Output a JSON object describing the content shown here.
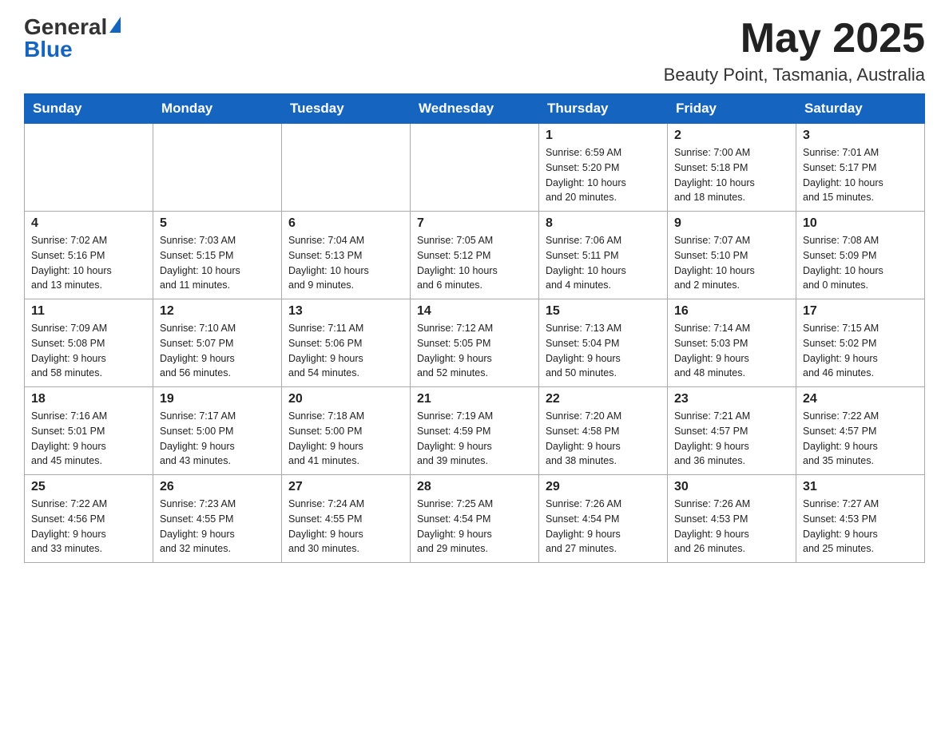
{
  "header": {
    "logo_general": "General",
    "logo_blue": "Blue",
    "month": "May 2025",
    "location": "Beauty Point, Tasmania, Australia"
  },
  "days_of_week": [
    "Sunday",
    "Monday",
    "Tuesday",
    "Wednesday",
    "Thursday",
    "Friday",
    "Saturday"
  ],
  "weeks": [
    [
      {
        "day": "",
        "info": ""
      },
      {
        "day": "",
        "info": ""
      },
      {
        "day": "",
        "info": ""
      },
      {
        "day": "",
        "info": ""
      },
      {
        "day": "1",
        "info": "Sunrise: 6:59 AM\nSunset: 5:20 PM\nDaylight: 10 hours\nand 20 minutes."
      },
      {
        "day": "2",
        "info": "Sunrise: 7:00 AM\nSunset: 5:18 PM\nDaylight: 10 hours\nand 18 minutes."
      },
      {
        "day": "3",
        "info": "Sunrise: 7:01 AM\nSunset: 5:17 PM\nDaylight: 10 hours\nand 15 minutes."
      }
    ],
    [
      {
        "day": "4",
        "info": "Sunrise: 7:02 AM\nSunset: 5:16 PM\nDaylight: 10 hours\nand 13 minutes."
      },
      {
        "day": "5",
        "info": "Sunrise: 7:03 AM\nSunset: 5:15 PM\nDaylight: 10 hours\nand 11 minutes."
      },
      {
        "day": "6",
        "info": "Sunrise: 7:04 AM\nSunset: 5:13 PM\nDaylight: 10 hours\nand 9 minutes."
      },
      {
        "day": "7",
        "info": "Sunrise: 7:05 AM\nSunset: 5:12 PM\nDaylight: 10 hours\nand 6 minutes."
      },
      {
        "day": "8",
        "info": "Sunrise: 7:06 AM\nSunset: 5:11 PM\nDaylight: 10 hours\nand 4 minutes."
      },
      {
        "day": "9",
        "info": "Sunrise: 7:07 AM\nSunset: 5:10 PM\nDaylight: 10 hours\nand 2 minutes."
      },
      {
        "day": "10",
        "info": "Sunrise: 7:08 AM\nSunset: 5:09 PM\nDaylight: 10 hours\nand 0 minutes."
      }
    ],
    [
      {
        "day": "11",
        "info": "Sunrise: 7:09 AM\nSunset: 5:08 PM\nDaylight: 9 hours\nand 58 minutes."
      },
      {
        "day": "12",
        "info": "Sunrise: 7:10 AM\nSunset: 5:07 PM\nDaylight: 9 hours\nand 56 minutes."
      },
      {
        "day": "13",
        "info": "Sunrise: 7:11 AM\nSunset: 5:06 PM\nDaylight: 9 hours\nand 54 minutes."
      },
      {
        "day": "14",
        "info": "Sunrise: 7:12 AM\nSunset: 5:05 PM\nDaylight: 9 hours\nand 52 minutes."
      },
      {
        "day": "15",
        "info": "Sunrise: 7:13 AM\nSunset: 5:04 PM\nDaylight: 9 hours\nand 50 minutes."
      },
      {
        "day": "16",
        "info": "Sunrise: 7:14 AM\nSunset: 5:03 PM\nDaylight: 9 hours\nand 48 minutes."
      },
      {
        "day": "17",
        "info": "Sunrise: 7:15 AM\nSunset: 5:02 PM\nDaylight: 9 hours\nand 46 minutes."
      }
    ],
    [
      {
        "day": "18",
        "info": "Sunrise: 7:16 AM\nSunset: 5:01 PM\nDaylight: 9 hours\nand 45 minutes."
      },
      {
        "day": "19",
        "info": "Sunrise: 7:17 AM\nSunset: 5:00 PM\nDaylight: 9 hours\nand 43 minutes."
      },
      {
        "day": "20",
        "info": "Sunrise: 7:18 AM\nSunset: 5:00 PM\nDaylight: 9 hours\nand 41 minutes."
      },
      {
        "day": "21",
        "info": "Sunrise: 7:19 AM\nSunset: 4:59 PM\nDaylight: 9 hours\nand 39 minutes."
      },
      {
        "day": "22",
        "info": "Sunrise: 7:20 AM\nSunset: 4:58 PM\nDaylight: 9 hours\nand 38 minutes."
      },
      {
        "day": "23",
        "info": "Sunrise: 7:21 AM\nSunset: 4:57 PM\nDaylight: 9 hours\nand 36 minutes."
      },
      {
        "day": "24",
        "info": "Sunrise: 7:22 AM\nSunset: 4:57 PM\nDaylight: 9 hours\nand 35 minutes."
      }
    ],
    [
      {
        "day": "25",
        "info": "Sunrise: 7:22 AM\nSunset: 4:56 PM\nDaylight: 9 hours\nand 33 minutes."
      },
      {
        "day": "26",
        "info": "Sunrise: 7:23 AM\nSunset: 4:55 PM\nDaylight: 9 hours\nand 32 minutes."
      },
      {
        "day": "27",
        "info": "Sunrise: 7:24 AM\nSunset: 4:55 PM\nDaylight: 9 hours\nand 30 minutes."
      },
      {
        "day": "28",
        "info": "Sunrise: 7:25 AM\nSunset: 4:54 PM\nDaylight: 9 hours\nand 29 minutes."
      },
      {
        "day": "29",
        "info": "Sunrise: 7:26 AM\nSunset: 4:54 PM\nDaylight: 9 hours\nand 27 minutes."
      },
      {
        "day": "30",
        "info": "Sunrise: 7:26 AM\nSunset: 4:53 PM\nDaylight: 9 hours\nand 26 minutes."
      },
      {
        "day": "31",
        "info": "Sunrise: 7:27 AM\nSunset: 4:53 PM\nDaylight: 9 hours\nand 25 minutes."
      }
    ]
  ]
}
